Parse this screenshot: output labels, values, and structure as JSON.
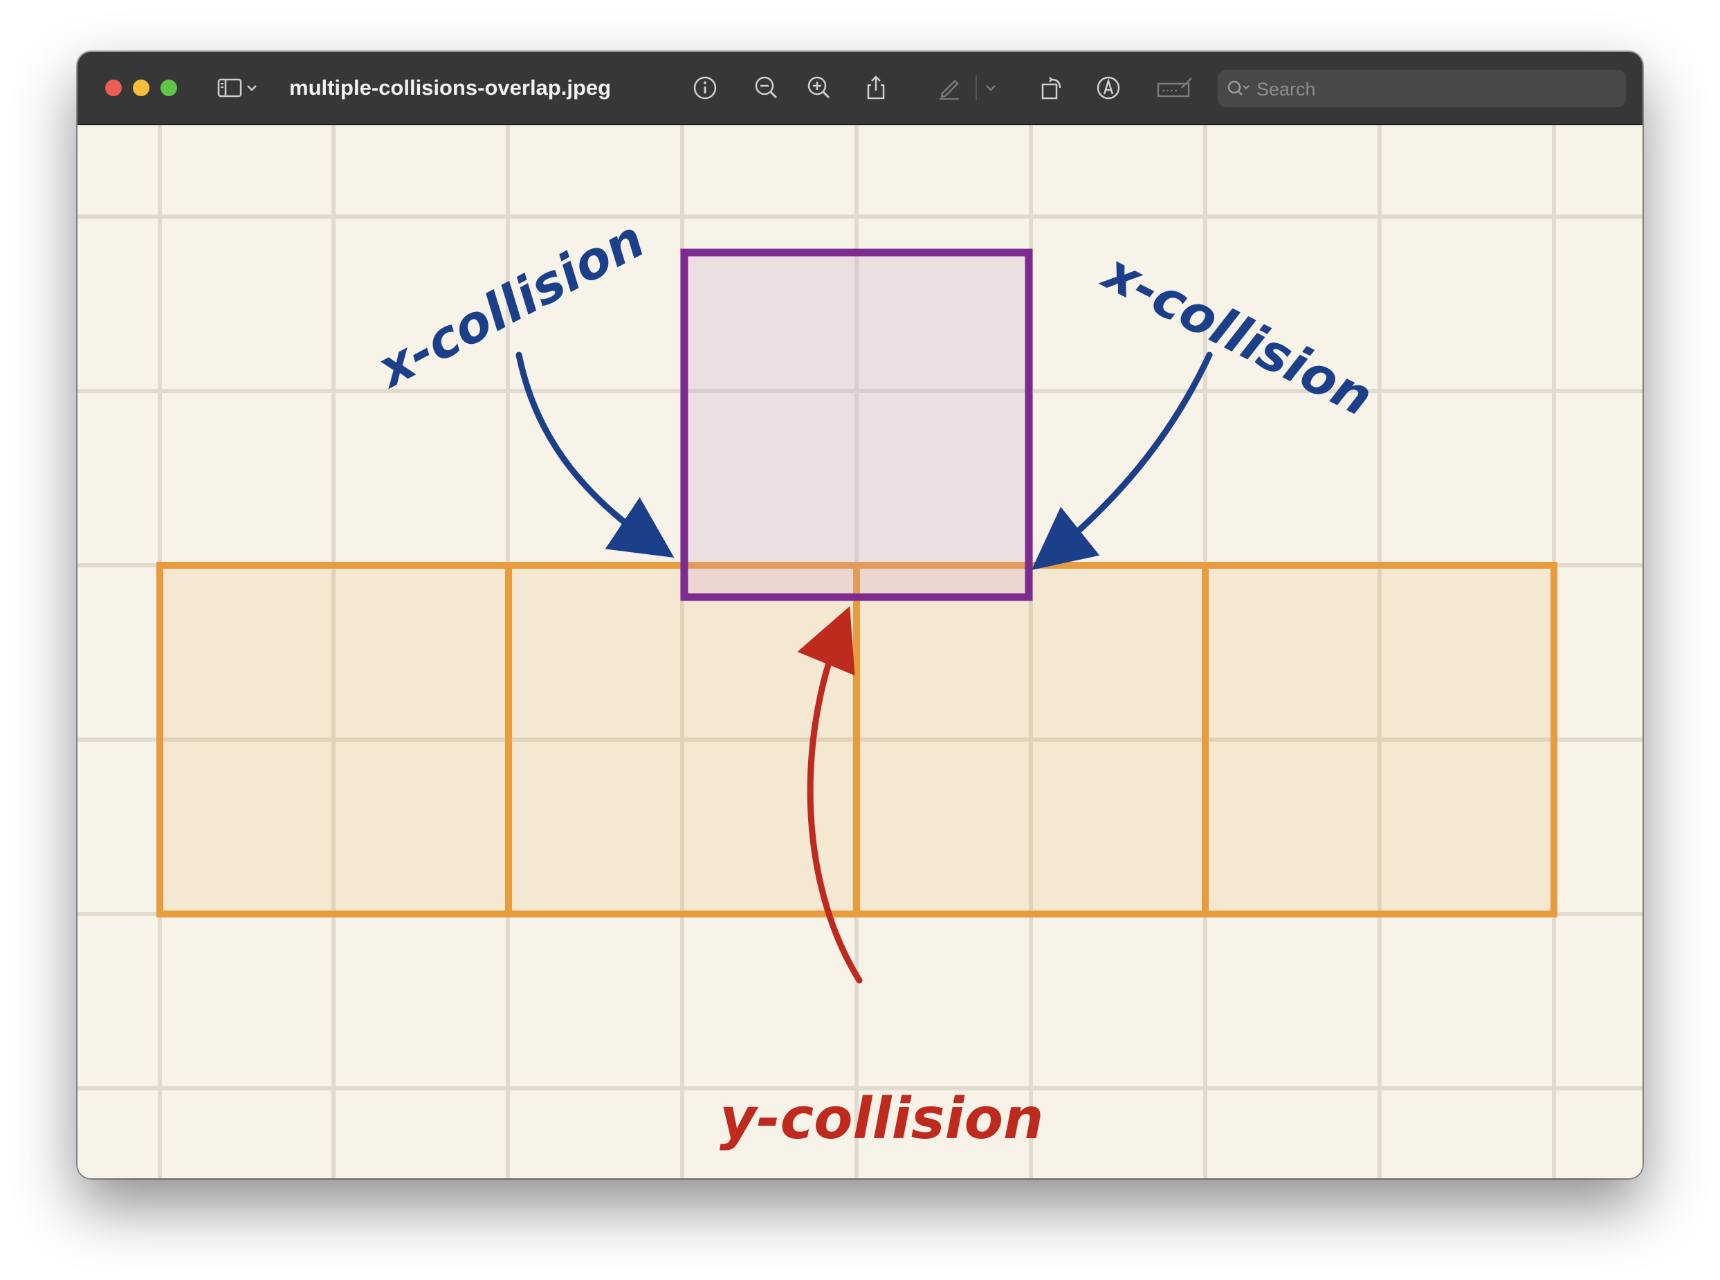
{
  "window": {
    "title": "multiple-collisions-overlap.jpeg",
    "search_placeholder": "Search"
  },
  "toolbar": {
    "icons": [
      "sidebar-toggle-icon",
      "chevron-down-icon",
      "info-icon",
      "zoom-out-icon",
      "zoom-in-icon",
      "share-icon",
      "markup-pen-icon",
      "rotate-icon",
      "annotate-icon",
      "signature-icon",
      "search-icon"
    ]
  },
  "diagram": {
    "labels": {
      "x_left": "x-collision",
      "x_right": "x-collision",
      "y": "y-collision"
    },
    "colors": {
      "background": "#f7f3e8",
      "grid": "#e0dbcd",
      "orange": "#e99c3e",
      "purple": "#7d2b8f",
      "blue": "#1c3f8a",
      "red": "#be2a1e"
    }
  }
}
